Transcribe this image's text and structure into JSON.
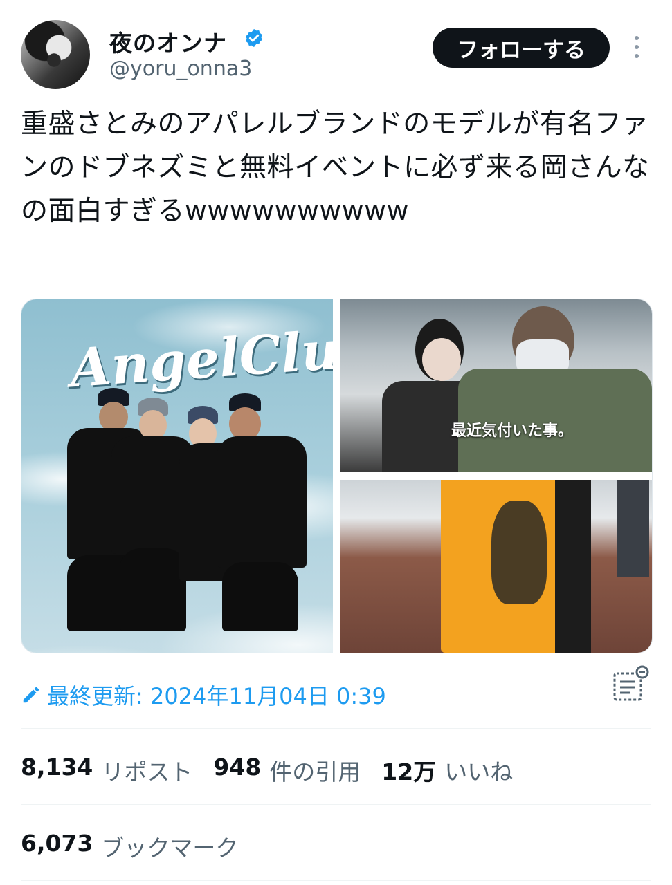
{
  "user": {
    "display_name": "夜のオンナ",
    "handle": "@yoru_onna3",
    "follow_label": "フォローする"
  },
  "tweet": {
    "text": "重盛さとみのアパレルブランドのモデルが有名ファンのドブネズミと無料イベントに必ず来る岡さんなの面白すぎるwwwwwwwwww",
    "media": {
      "logo_text": "AngelClub",
      "caption": "最近気付いた事。"
    },
    "edited_label": "最終更新: 2024年11月04日 0:39"
  },
  "stats": {
    "reposts": "8,134",
    "reposts_label": "リポスト",
    "quotes": "948",
    "quotes_label": "件の引用",
    "likes": "12万",
    "likes_label": "いいね",
    "bookmarks": "6,073",
    "bookmarks_label": "ブックマーク"
  },
  "colors": {
    "accent": "#1d9bf0",
    "text": "#0f1419",
    "muted": "#536471"
  },
  "icons": [
    "verified-badge-icon",
    "more-icon",
    "pencil-icon",
    "community-notes-icon"
  ]
}
